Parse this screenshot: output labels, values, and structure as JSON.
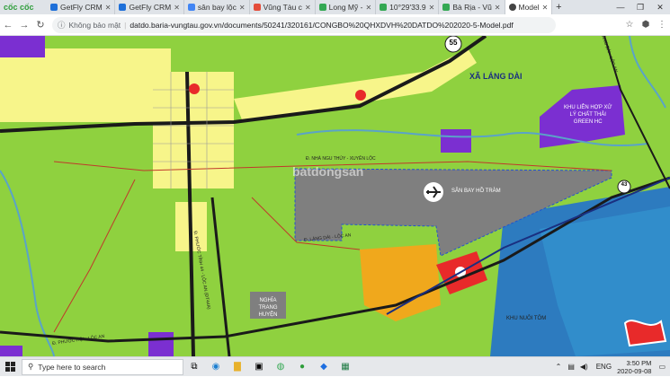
{
  "browser": {
    "logo": "cốc cốc",
    "tabs": [
      {
        "label": "GetFly CRM",
        "color": "#1e6fd9"
      },
      {
        "label": "GetFly CRM",
        "color": "#1e6fd9"
      },
      {
        "label": "sân bay lộc",
        "color": "#4285f4"
      },
      {
        "label": "Vũng Tàu c",
        "color": "#e44d3a"
      },
      {
        "label": "Long Mỹ -",
        "color": "#34a853"
      },
      {
        "label": "10°29'33.9",
        "color": "#34a853"
      },
      {
        "label": "Bà Rịa - Vũ",
        "color": "#34a853"
      },
      {
        "label": "Model",
        "color": "#444"
      }
    ],
    "new_tab": "+",
    "insecure_label": "Không bảo mật",
    "url": "datdo.baria-vungtau.gov.vn/documents/50241/320161/CONGBO%20QHXDVH%20DATDO%202020-5-Model.pdf"
  },
  "map": {
    "colors": {
      "farmland": "#8fd13f",
      "urban": "#f7f58a",
      "airport": "#7f7f7f",
      "industrial": "#7b2fd1",
      "commercial": "#f0a81c",
      "red_zone": "#e82a2a",
      "water": "#2d7bbf",
      "road": "#1a1a1a",
      "river": "#5aa3c8"
    },
    "labels": {
      "commune": "XÃ LÁNG DÀI",
      "waste_zone": [
        "KHU LIÊN HỢP XỬ",
        "LÝ CHẤT THẢI",
        "GREEN HC"
      ],
      "airport": "SÂN BAY HỒ TRÀM",
      "cemetery": [
        "NGHĨA TRANG",
        "HUYỆN"
      ],
      "shrimp": "KHU NUÔI TÔM",
      "road_55": "55",
      "road_43": "43",
      "road_lang_dai": "Đ. LÁNG DÀI - LỘC AN",
      "road_phuoc_hoi": "Đ. PHƯỚC HỘI - LỘC AN",
      "road_nha_ngu": "Đ. NHÀ NGU THỦY - XUYÊN LỘC",
      "road_vertical": "Đ. PHƯỚC TỈNH 44 - LỘC AN (ĐT44A)",
      "road_top_right": "LÁNG DÀI - LỘC AN",
      "watermark": "batdongsan"
    }
  },
  "taskbar": {
    "search_placeholder": "Type here to search",
    "lang": "ENG",
    "time": "3:50 PM",
    "date": "2020-09-08"
  }
}
